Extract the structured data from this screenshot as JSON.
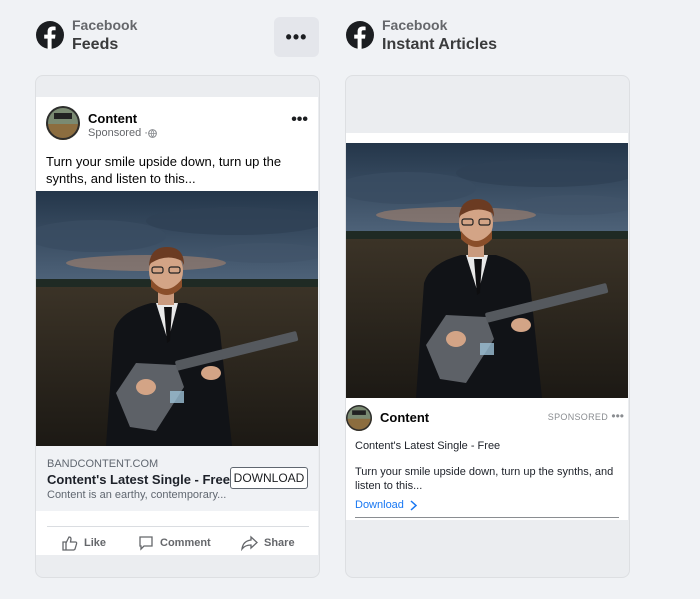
{
  "placements": [
    {
      "platform": "Facebook",
      "placement": "Feeds"
    },
    {
      "platform": "Facebook",
      "placement": "Instant Articles"
    }
  ],
  "more_button_label": "•••",
  "feed_ad": {
    "page_name": "Content",
    "sponsored": "Sponsored · ",
    "primary_text": "Turn your smile upside down, turn up the synths, and listen to this...",
    "link_domain": "BANDCONTENT.COM",
    "headline": "Content's Latest Single - Free",
    "description": "Content is an earthy, contemporary...",
    "cta": "DOWNLOAD",
    "actions": {
      "like": "Like",
      "comment": "Comment",
      "share": "Share"
    }
  },
  "instant_ad": {
    "page_name": "Content",
    "sponsored": "SPONSORED",
    "headline": "Content's Latest Single - Free",
    "primary_text": "Turn your smile upside down, turn up the synths, and listen to this...",
    "link_label": "Download"
  },
  "colors": {
    "link": "#1877f2",
    "facebook_blue": "#1c1e21"
  }
}
